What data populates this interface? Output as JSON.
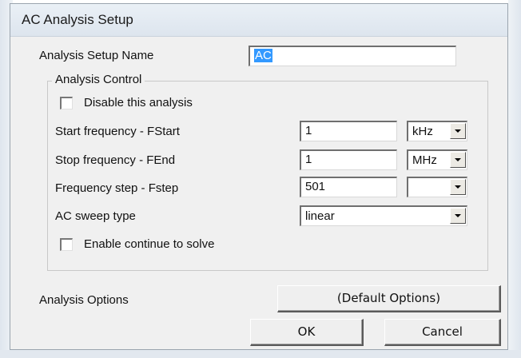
{
  "dialog": {
    "title": "AC Analysis Setup"
  },
  "setup_name": {
    "label": "Analysis Setup Name",
    "value": "AC"
  },
  "analysis_control": {
    "group_label": "Analysis Control",
    "disable_label": "Disable this analysis",
    "disable_checked": false,
    "start_freq": {
      "label": "Start frequency - FStart",
      "value": "1",
      "unit": "kHz"
    },
    "stop_freq": {
      "label": "Stop frequency - FEnd",
      "value": "1",
      "unit": "MHz"
    },
    "freq_step": {
      "label": "Frequency step - Fstep",
      "value": "501",
      "unit": ""
    },
    "sweep_type": {
      "label": "AC sweep type",
      "value": "linear"
    },
    "continue_label": "Enable continue to solve",
    "continue_checked": false
  },
  "options": {
    "label": "Analysis Options",
    "button_label": "(Default Options)"
  },
  "footer": {
    "ok_label": "OK",
    "cancel_label": "Cancel"
  }
}
